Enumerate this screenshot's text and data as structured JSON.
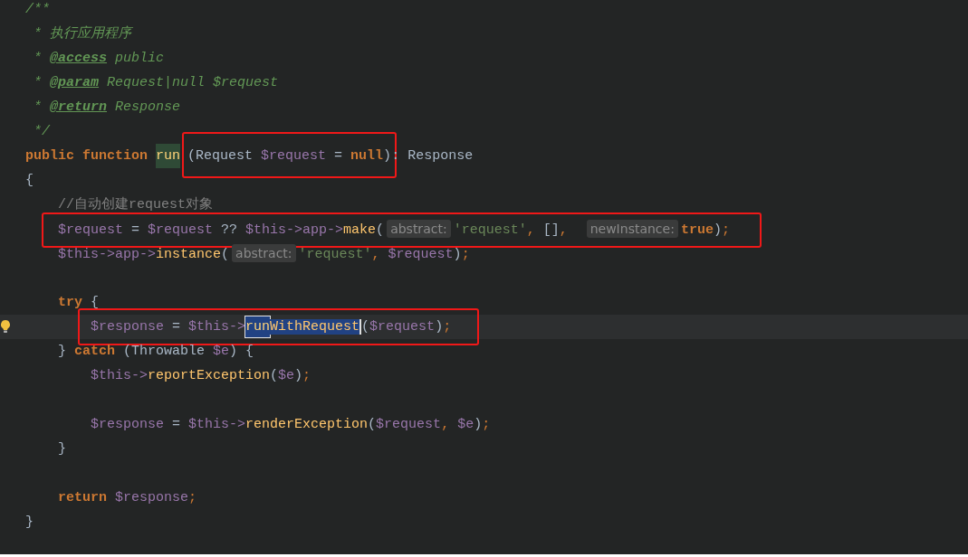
{
  "editor": {
    "lines": [
      {
        "kind": "code",
        "tokens": [
          {
            "kind": "doc",
            "text": "/**"
          }
        ]
      },
      {
        "kind": "code",
        "tokens": [
          {
            "kind": "doc",
            "text": " * 执行应用程序"
          }
        ]
      },
      {
        "kind": "code",
        "tokens": [
          {
            "kind": "doc",
            "text": " * "
          },
          {
            "kind": "doctag",
            "text": "@access"
          },
          {
            "kind": "doc",
            "text": " public"
          }
        ]
      },
      {
        "kind": "code",
        "tokens": [
          {
            "kind": "doc",
            "text": " * "
          },
          {
            "kind": "doctag",
            "text": "@param"
          },
          {
            "kind": "doc",
            "text": " Request|null $request"
          }
        ]
      },
      {
        "kind": "code",
        "tokens": [
          {
            "kind": "doc",
            "text": " * "
          },
          {
            "kind": "doctag",
            "text": "@return"
          },
          {
            "kind": "doc",
            "text": " Response"
          }
        ]
      },
      {
        "kind": "code",
        "tokens": [
          {
            "kind": "doc",
            "text": " */"
          }
        ]
      },
      {
        "kind": "code",
        "tokens": [
          {
            "kind": "keyword",
            "text": "public function "
          },
          {
            "kind": "usage",
            "text": "run"
          },
          {
            "kind": "frame",
            "children": [
              {
                "kind": "text",
                "text": "(Request "
              },
              {
                "kind": "var",
                "text": "$request"
              },
              {
                "kind": "text",
                "text": " = "
              },
              {
                "kind": "keyword",
                "text": "null"
              },
              {
                "kind": "text",
                "text": ")"
              }
            ]
          },
          {
            "kind": "text",
            "text": ": Response"
          }
        ]
      },
      {
        "kind": "code",
        "tokens": [
          {
            "kind": "text",
            "text": "{"
          }
        ]
      },
      {
        "kind": "code",
        "tokens": [
          {
            "kind": "comment",
            "text": "    //自动创建request对象"
          }
        ]
      },
      {
        "kind": "code",
        "tokens": [
          {
            "kind": "frame",
            "children": [
              {
                "kind": "var",
                "text": "$request"
              },
              {
                "kind": "text",
                "text": " = "
              },
              {
                "kind": "var",
                "text": "$request"
              },
              {
                "kind": "text",
                "text": " ?? "
              },
              {
                "kind": "var",
                "text": "$this->app->"
              },
              {
                "kind": "func",
                "text": "make"
              },
              {
                "kind": "text",
                "text": "("
              },
              {
                "kind": "hint",
                "text": "abstract:"
              },
              {
                "kind": "string",
                "text": "'request'"
              },
              {
                "kind": "punct",
                "text": ", "
              },
              {
                "kind": "text",
                "text": "[]"
              },
              {
                "kind": "punct",
                "text": ",  "
              },
              {
                "kind": "hint",
                "text": "newInstance:"
              },
              {
                "kind": "keyword",
                "text": "true"
              },
              {
                "kind": "text",
                "text": ")"
              },
              {
                "kind": "punct",
                "text": ";"
              }
            ]
          }
        ]
      },
      {
        "kind": "code",
        "tokens": [
          {
            "kind": "var",
            "text": "    $this->app->"
          },
          {
            "kind": "func",
            "text": "instance"
          },
          {
            "kind": "text",
            "text": "("
          },
          {
            "kind": "hint",
            "text": "abstract:"
          },
          {
            "kind": "string",
            "text": "'request'"
          },
          {
            "kind": "punct",
            "text": ", "
          },
          {
            "kind": "var",
            "text": "$request"
          },
          {
            "kind": "text",
            "text": ")"
          },
          {
            "kind": "punct",
            "text": ";"
          }
        ]
      },
      {
        "kind": "blank"
      },
      {
        "kind": "code",
        "tokens": [
          {
            "kind": "keyword",
            "text": "    try"
          },
          {
            "kind": "text",
            "text": " {"
          }
        ]
      },
      {
        "kind": "code",
        "current": true,
        "tokens": [
          {
            "kind": "frame",
            "children": [
              {
                "kind": "var",
                "text": "$response"
              },
              {
                "kind": "text",
                "text": " = "
              },
              {
                "kind": "var",
                "text": "$this->"
              },
              {
                "kind": "match",
                "text": "run"
              },
              {
                "kind": "selected",
                "text": "WithRequest"
              },
              {
                "kind": "text",
                "text": "("
              },
              {
                "kind": "var",
                "text": "$request"
              },
              {
                "kind": "text",
                "text": ")"
              },
              {
                "kind": "punct",
                "text": ";"
              }
            ]
          }
        ]
      },
      {
        "kind": "code",
        "tokens": [
          {
            "kind": "text",
            "text": "    } "
          },
          {
            "kind": "keyword",
            "text": "catch"
          },
          {
            "kind": "text",
            "text": " (Throwable "
          },
          {
            "kind": "var",
            "text": "$e"
          },
          {
            "kind": "text",
            "text": ") {"
          }
        ]
      },
      {
        "kind": "code",
        "tokens": [
          {
            "kind": "var",
            "text": "        $this->"
          },
          {
            "kind": "func",
            "text": "reportException"
          },
          {
            "kind": "text",
            "text": "("
          },
          {
            "kind": "var",
            "text": "$e"
          },
          {
            "kind": "text",
            "text": ")"
          },
          {
            "kind": "punct",
            "text": ";"
          }
        ]
      },
      {
        "kind": "blank"
      },
      {
        "kind": "code",
        "tokens": [
          {
            "kind": "var",
            "text": "        $response"
          },
          {
            "kind": "text",
            "text": " = "
          },
          {
            "kind": "var",
            "text": "$this->"
          },
          {
            "kind": "func",
            "text": "renderException"
          },
          {
            "kind": "text",
            "text": "("
          },
          {
            "kind": "var",
            "text": "$request"
          },
          {
            "kind": "punct",
            "text": ", "
          },
          {
            "kind": "var",
            "text": "$e"
          },
          {
            "kind": "text",
            "text": ")"
          },
          {
            "kind": "punct",
            "text": ";"
          }
        ]
      },
      {
        "kind": "code",
        "tokens": [
          {
            "kind": "text",
            "text": "    }"
          }
        ]
      },
      {
        "kind": "blank"
      },
      {
        "kind": "code",
        "tokens": [
          {
            "kind": "keyword",
            "text": "    return "
          },
          {
            "kind": "var",
            "text": "$response"
          },
          {
            "kind": "punct",
            "text": ";"
          }
        ]
      },
      {
        "kind": "code",
        "tokens": [
          {
            "kind": "text",
            "text": "}"
          }
        ]
      }
    ]
  }
}
